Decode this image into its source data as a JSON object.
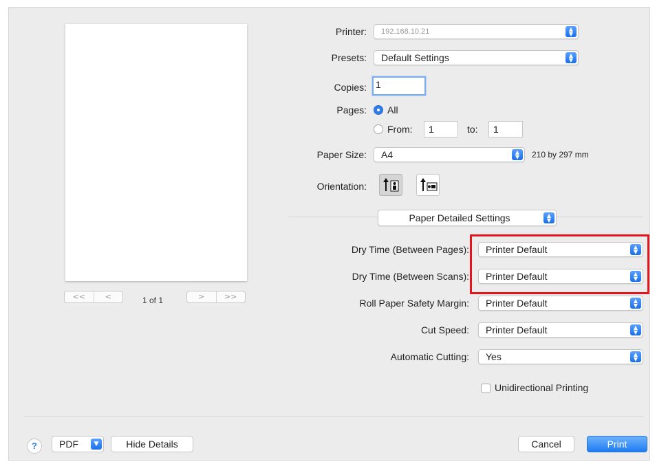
{
  "printer": {
    "label": "Printer:",
    "value": "192.168.10.21"
  },
  "presets": {
    "label": "Presets:",
    "value": "Default Settings"
  },
  "copies": {
    "label": "Copies:",
    "value": "1"
  },
  "pages": {
    "label": "Pages:",
    "all_label": "All",
    "from_label": "From:",
    "from_value": "1",
    "to_label": "to:",
    "to_value": "1",
    "selected": "All"
  },
  "paper_size": {
    "label": "Paper Size:",
    "value": "A4",
    "dimensions": "210 by 297 mm"
  },
  "orientation": {
    "label": "Orientation:",
    "selected": "portrait"
  },
  "section_menu": {
    "value": "Paper Detailed Settings"
  },
  "settings": {
    "dry_time_pages": {
      "label": "Dry Time (Between Pages):",
      "value": "Printer Default"
    },
    "dry_time_scans": {
      "label": "Dry Time (Between Scans):",
      "value": "Printer Default"
    },
    "roll_margin": {
      "label": "Roll Paper Safety Margin:",
      "value": "Printer Default"
    },
    "cut_speed": {
      "label": "Cut Speed:",
      "value": "Printer Default"
    },
    "auto_cutting": {
      "label": "Automatic Cutting:",
      "value": "Yes"
    },
    "unidirectional": {
      "label": "Unidirectional Printing",
      "checked": false
    }
  },
  "preview": {
    "page_count": "1 of 1",
    "first": "<<",
    "prev": "<",
    "next": ">",
    "last": ">>"
  },
  "footer": {
    "help": "?",
    "pdf": "PDF",
    "hide_details": "Hide Details",
    "cancel": "Cancel",
    "print": "Print"
  },
  "colors": {
    "accent": "#2f7be8",
    "highlight": "#e3141b"
  }
}
